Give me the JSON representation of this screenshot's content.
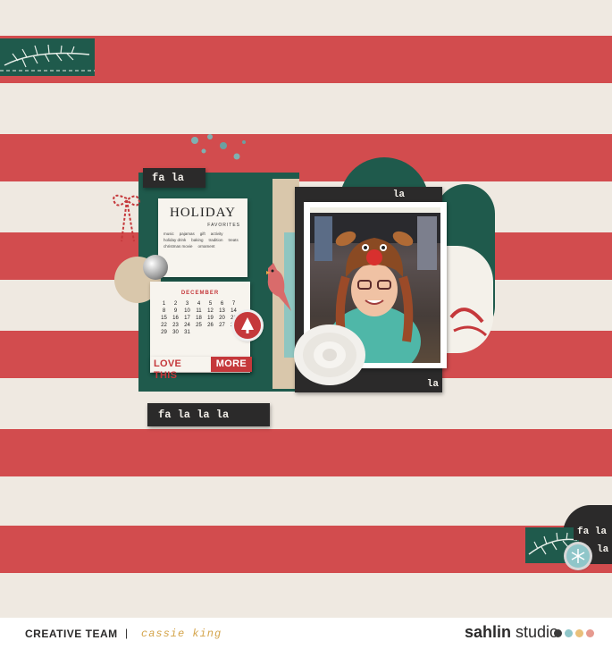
{
  "journal_card": {
    "title": "HOLIDAY",
    "subtitle": "FAVORITES",
    "list_items": [
      "music",
      "pajamas",
      "gift",
      "activity",
      "holiday drink",
      "baking",
      "tradition",
      "treats",
      "christmas movie",
      "ornament"
    ]
  },
  "calendar": {
    "month": "DECEMBER",
    "days": [
      "1",
      "2",
      "3",
      "4",
      "5",
      "6",
      "7",
      "8",
      "9",
      "10",
      "11",
      "12",
      "13",
      "14",
      "15",
      "16",
      "17",
      "18",
      "19",
      "20",
      "21",
      "22",
      "23",
      "24",
      "25",
      "26",
      "27",
      "28",
      "29",
      "30",
      "31"
    ]
  },
  "labels": {
    "fa_la_top": "fa la",
    "la_top": "la",
    "la_bottom": "la",
    "fa_la_la_la": "fa la la la",
    "love_this": "LOVE THIS",
    "more": "MORE",
    "corner_fa_la": "fa la",
    "corner_la": "la"
  },
  "footer": {
    "creative_team": "CREATIVE TEAM",
    "separator": "|",
    "designer": "cassie king",
    "brand_bold": "sahlin",
    "brand_light": "studio"
  },
  "colors": {
    "stripe_red": "#d24c4e",
    "cream": "#efe9e1",
    "pine_green": "#1f5a4c",
    "charcoal": "#2b2a2a",
    "gold": "#d4a44a",
    "dot_colors": [
      "#3a3a3a",
      "#8fc6c9",
      "#e9c07a",
      "#e69a8f"
    ]
  },
  "icons": [
    "tree-badge-icon",
    "snowflake-icon",
    "jingle-bell-icon",
    "cardinal-bird-icon",
    "paper-flower-icon",
    "twine-bow-icon"
  ]
}
